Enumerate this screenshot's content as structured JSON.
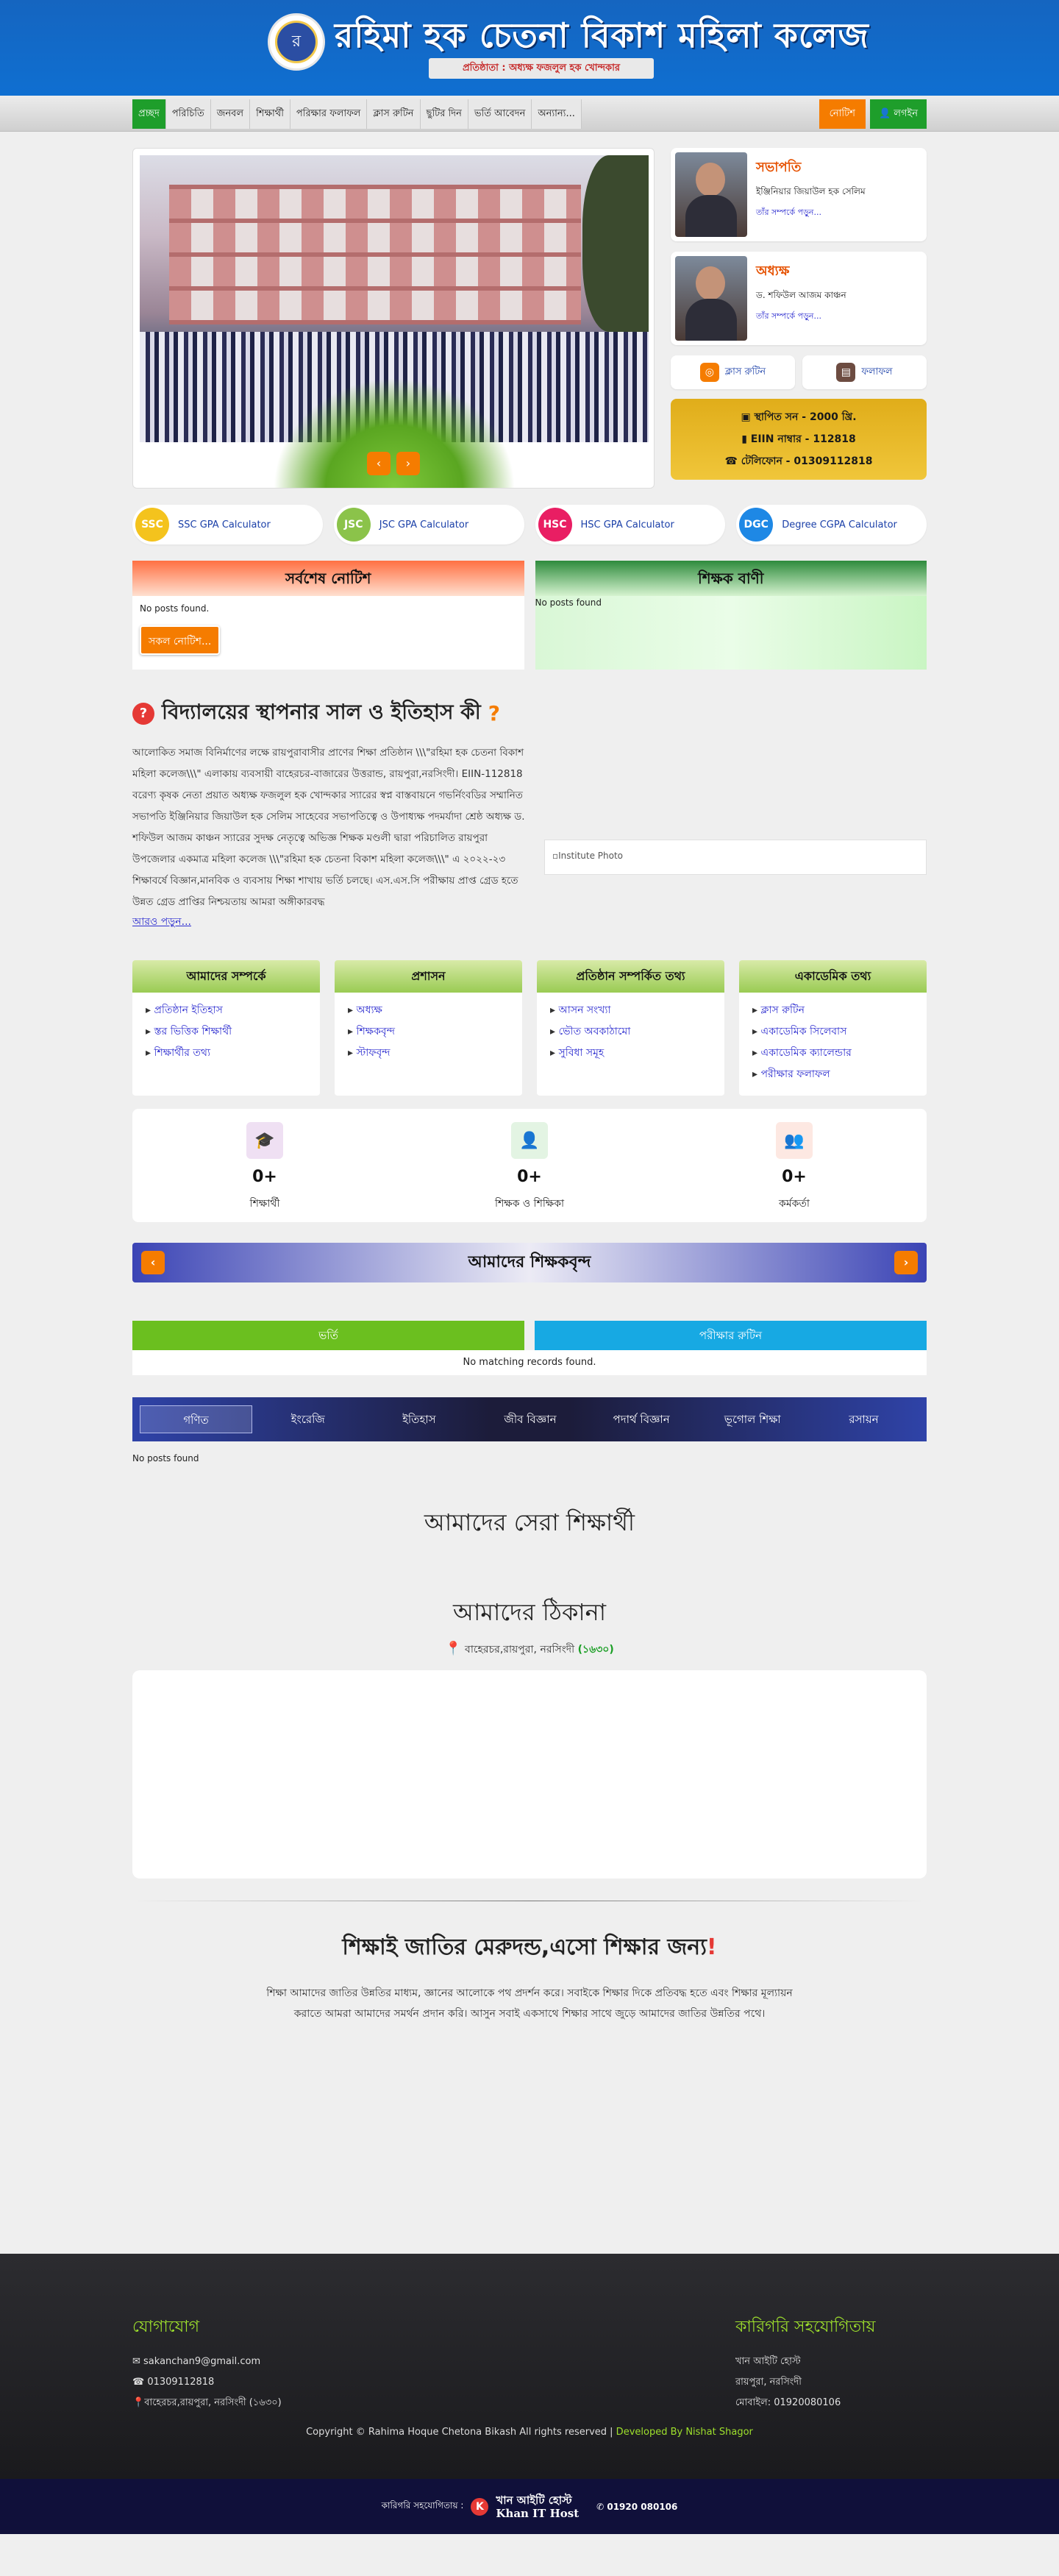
{
  "header": {
    "logo_text": "র",
    "title": "রহিমা হক চেতনা বিকাশ মহিলা কলেজ",
    "founder": "প্রতিষ্ঠাতা : অধ্যক্ষ ফজলুল হক খোন্দকার"
  },
  "nav": {
    "items": [
      "প্রচ্ছদ",
      "পরিচিতি",
      "জনবল",
      "শিক্ষার্থী",
      "পরিক্ষার ফলাফল",
      "ক্লাস রুটিন",
      "ছুটির দিন",
      "ভর্তি আবেদন",
      "অন্যান্য..."
    ],
    "notice": "নোটিশ",
    "login": "লগইন"
  },
  "slider": {
    "prev": "‹",
    "next": "›"
  },
  "chairman": {
    "title": "সভাপতি",
    "name": "ইঞ্জিনিয়ার জিয়াউল হক সেলিম",
    "link": "তাঁর সম্পর্কে পড়ুন..."
  },
  "principal": {
    "title": "অধ্যক্ষ",
    "name": "ড. শফিউল আজম কাঞ্চন",
    "link": "তাঁর সম্পর্কে পড়ুন..."
  },
  "quick": {
    "routine": "ক্লাস রুটিন",
    "result": "ফলাফল"
  },
  "info": {
    "established": "স্থাপিত সন - 2000 খ্রি.",
    "eiin": "EIIN নাম্বার - 112818",
    "phone": "টেলিফোন - 01309112818"
  },
  "gpa": [
    {
      "badge": "SSC",
      "label": "SSC GPA Calculator",
      "color": "#f4c31d"
    },
    {
      "badge": "JSC",
      "label": "JSC GPA Calculator",
      "color": "#8bc34a"
    },
    {
      "badge": "HSC",
      "label": "HSC GPA Calculator",
      "color": "#e91e63"
    },
    {
      "badge": "DGC",
      "label": "Degree CGPA Calculator",
      "color": "#1e88e5"
    }
  ],
  "notice_panel": {
    "title": "সর্বশেষ নোটিশ",
    "empty": "No posts found.",
    "all_button": "সকল নোটিশ..."
  },
  "teacher_speech": {
    "title": "শিক্ষক বাণী",
    "empty": "No posts found"
  },
  "history": {
    "title": "বিদ্যালয়ের স্থাপনার সাল ও ইতিহাস কী",
    "qmark": "?",
    "text": "আলোকিত সমাজ বিনির্মাণের লক্ষে রায়পুরাবাসীর প্রাণের শিক্ষা প্রতিষ্ঠান \\\\\\\"রহিমা হক চেতনা বিকাশ মহিলা কলেজ\\\\\\\" এলাকায় ব্যবসায়ী বাহেরচর-বাজারের উত্তরান্ড, রায়পুরা,নরসিংদী। EIIN-112818 বরেণ্য কৃষক নেতা প্রয়াত অধ্যক্ষ ফজলুল হক খোন্দকার স্যারের স্বপ্ন বাস্তবায়নে গভর্নিংবডির সম্মানিত সভাপতি ইঞ্জিনিয়ার জিয়াউল হক সেলিম সাহেবের সভাপতিত্বে ও উপাধ্যক্ষ পদমর্যাদা শ্রেষ্ঠ অধ্যক্ষ ড. শফিউল আজম কাঞ্চন স্যারের সুদক্ষ নেতৃত্বে অভিজ্ঞ শিক্ষক মণ্ডলী দ্বারা পরিচালিত রায়পুরা উপজেলার একমাত্র মহিলা কলেজ \\\\\\\"রহিমা হক চেতনা বিকাশ মহিলা কলেজ\\\\\\\" এ ২০২২-২৩ শিক্ষাবর্ষে বিজ্ঞান,মানবিক ও ব্যবসায় শিক্ষা শাখায় ভর্তি চলছে। এস.এস.সি পরীক্ষায় প্রাপ্ত গ্রেড হতে উন্নত গ্রেড প্রাপ্তির নিশ্চয়তায় আমরা অঙ্গীকারবদ্ধ",
    "more": "আরও পড়ুন...",
    "image_alt": "Institute Photo"
  },
  "columns": [
    {
      "title": "আমাদের সম্পর্কে",
      "items": [
        "প্রতিষ্ঠান ইতিহাস",
        "স্তর ভিত্তিক শিক্ষার্থী",
        "শিক্ষার্থীর তথ্য"
      ]
    },
    {
      "title": "প্রশাসন",
      "items": [
        "অধ্যক্ষ",
        "শিক্ষকবৃন্দ",
        "স্টাফবৃন্দ"
      ]
    },
    {
      "title": "প্রতিষ্ঠান সম্পর্কিত তথ্য",
      "items": [
        "আসন সংখ্যা",
        "ভৌত অবকাঠামো",
        "সুবিধা সমূহ"
      ]
    },
    {
      "title": "একাডেমিক তথ্য",
      "items": [
        "ক্লাস রুটিন",
        "একাডেমিক সিলেবাস",
        "একাডেমিক ক্যালেন্ডার",
        "পরীক্ষার ফলাফল"
      ]
    }
  ],
  "stats": [
    {
      "icon": "graduation-cap-icon",
      "glyph": "🎓",
      "value": "0+",
      "label": "শিক্ষার্থী",
      "bg": "#efe0f3",
      "fg": "#8e24aa"
    },
    {
      "icon": "teacher-icon",
      "glyph": "👤",
      "value": "0+",
      "label": "শিক্ষক ও শিক্ষিকা",
      "bg": "#e3f4e3",
      "fg": "#43a047"
    },
    {
      "icon": "staff-icon",
      "glyph": "👥",
      "value": "0+",
      "label": "কর্মকর্তা",
      "bg": "#fde8e2",
      "fg": "#e64a19"
    }
  ],
  "teachers": {
    "title": "আমাদের শিক্ষকবৃন্দ",
    "prev": "‹",
    "next": "›"
  },
  "tabs": {
    "admission": "ভর্তি",
    "exam_routine": "পরীক্ষার রুটিন",
    "empty": "No matching records found."
  },
  "subjects": {
    "items": [
      "গণিত",
      "ইংরেজি",
      "ইতিহাস",
      "জীব বিজ্ঞান",
      "পদার্থ বিজ্ঞান",
      "ভূগোল শিক্ষা",
      "রসায়ন"
    ],
    "empty": "No posts found"
  },
  "best_students": {
    "title": "আমাদের সেরা শিক্ষার্থী"
  },
  "address": {
    "title": "আমাদের ঠিকানা",
    "text": "বাহেরচর,রায়পুরা, নরসিংদী",
    "code": "(১৬৩০)"
  },
  "motto": {
    "title": "শিক্ষাই জাতির মেরুদন্ড,এসো শিক্ষার জন্য",
    "ex": "!",
    "text": "শিক্ষা আমাদের জাতির উন্নতির মাধ্যম, জ্ঞানের আলোকে পথ প্রদর্শন করে। সবাইকে শিক্ষার দিকে প্রতিবদ্ধ হতে এবং শিক্ষার মূল্যায়ন করাতে আমরা আমাদের সমর্থন প্রদান করি। আসুন সবাই একসাথে শিক্ষার সাথে জুড়ে আমাদের জাতির উন্নতির পথে।"
  },
  "footer": {
    "contact_title": "যোগাযোগ",
    "email": "sakanchan9@gmail.com",
    "phone": "01309112818",
    "address": "বাহেরচর,রায়পুরা, নরসিংদী (১৬৩০)",
    "tech_title": "কারিগরি সহযোগিতায়",
    "tech_name": "খান আইটি হোস্ট",
    "tech_place": "রায়পুরা, নরসিংদী",
    "tech_phone": "মোবাইল: 01920080106",
    "copyright": "Copyright © Rahima Hoque Chetona Bikash All rights reserved |",
    "developer": " Developed By Nishat Shagor",
    "credit_label": "কারিগরি সহযোগিতায় :",
    "credit_bn": "খান আইটি হোস্ট",
    "credit_en": "Khan IT Host",
    "credit_phone": "01920 080106"
  },
  "colors": {
    "header_blue": "#1565c0",
    "green": "#1e9e2b",
    "orange": "#f57c00",
    "gold": "#e0ad1a"
  }
}
